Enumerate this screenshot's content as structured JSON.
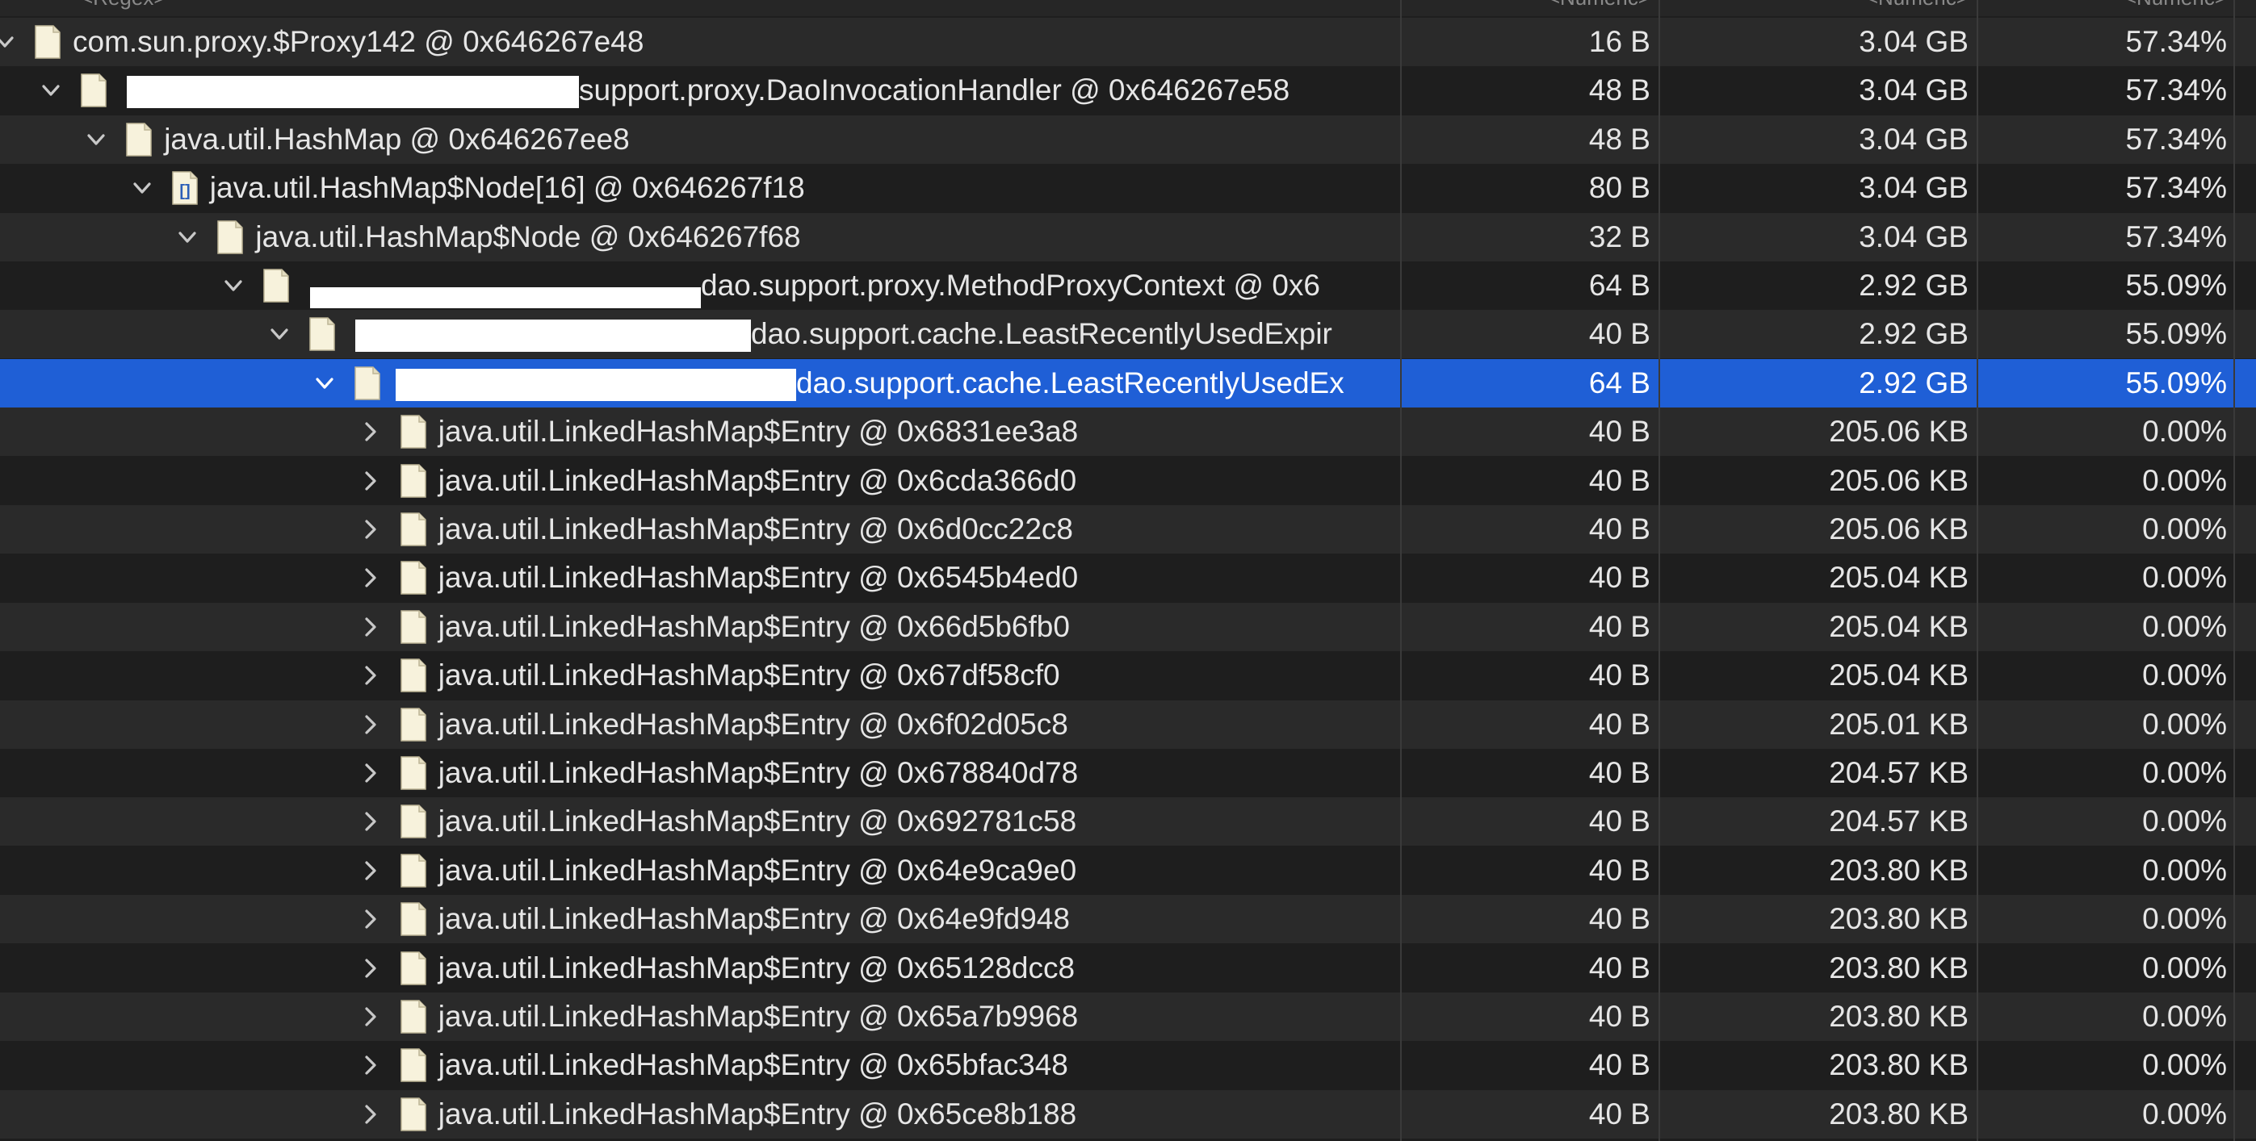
{
  "columns": {
    "name": "<Regex>",
    "shallow": "<Numeric>",
    "retained": "<Numeric>",
    "percent": "<Numeric>"
  },
  "rows": [
    {
      "label": "com.sun.proxy.$Proxy142 @ 0x646267e48",
      "shallow": "16 B",
      "retained": "3.04 GB",
      "percent": "57.34%",
      "icon": "file-icon",
      "expanded": true
    },
    {
      "label": "support.proxy.DaoInvocationHandler @ 0x646267e58",
      "shallow": "48 B",
      "retained": "3.04 GB",
      "percent": "57.34%",
      "icon": "file-icon",
      "expanded": true,
      "redacted": true
    },
    {
      "label": "java.util.HashMap @ 0x646267ee8",
      "shallow": "48 B",
      "retained": "3.04 GB",
      "percent": "57.34%",
      "icon": "file-icon",
      "expanded": true
    },
    {
      "label": "java.util.HashMap$Node[16] @ 0x646267f18",
      "shallow": "80 B",
      "retained": "3.04 GB",
      "percent": "57.34%",
      "icon": "array-icon",
      "expanded": true
    },
    {
      "label": "java.util.HashMap$Node @ 0x646267f68",
      "shallow": "32 B",
      "retained": "3.04 GB",
      "percent": "57.34%",
      "icon": "file-icon",
      "expanded": true
    },
    {
      "label": "dao.support.proxy.MethodProxyContext @ 0x6",
      "shallow": "64 B",
      "retained": "2.92 GB",
      "percent": "55.09%",
      "icon": "file-icon",
      "expanded": true,
      "redacted": true
    },
    {
      "label": "dao.support.cache.LeastRecentlyUsedExpir",
      "shallow": "40 B",
      "retained": "2.92 GB",
      "percent": "55.09%",
      "icon": "file-icon",
      "expanded": true,
      "redacted": true
    },
    {
      "label": "dao.support.cache.LeastRecentlyUsedEx",
      "shallow": "64 B",
      "retained": "2.92 GB",
      "percent": "55.09%",
      "icon": "file-icon",
      "expanded": true,
      "redacted": true,
      "selected": true
    },
    {
      "label": "java.util.LinkedHashMap$Entry @ 0x6831ee3a8",
      "shallow": "40 B",
      "retained": "205.06 KB",
      "percent": "0.00%",
      "icon": "file-icon",
      "expanded": false
    },
    {
      "label": "java.util.LinkedHashMap$Entry @ 0x6cda366d0",
      "shallow": "40 B",
      "retained": "205.06 KB",
      "percent": "0.00%",
      "icon": "file-icon",
      "expanded": false
    },
    {
      "label": "java.util.LinkedHashMap$Entry @ 0x6d0cc22c8",
      "shallow": "40 B",
      "retained": "205.06 KB",
      "percent": "0.00%",
      "icon": "file-icon",
      "expanded": false
    },
    {
      "label": "java.util.LinkedHashMap$Entry @ 0x6545b4ed0",
      "shallow": "40 B",
      "retained": "205.04 KB",
      "percent": "0.00%",
      "icon": "file-icon",
      "expanded": false
    },
    {
      "label": "java.util.LinkedHashMap$Entry @ 0x66d5b6fb0",
      "shallow": "40 B",
      "retained": "205.04 KB",
      "percent": "0.00%",
      "icon": "file-icon",
      "expanded": false
    },
    {
      "label": "java.util.LinkedHashMap$Entry @ 0x67df58cf0",
      "shallow": "40 B",
      "retained": "205.04 KB",
      "percent": "0.00%",
      "icon": "file-icon",
      "expanded": false
    },
    {
      "label": "java.util.LinkedHashMap$Entry @ 0x6f02d05c8",
      "shallow": "40 B",
      "retained": "205.01 KB",
      "percent": "0.00%",
      "icon": "file-icon",
      "expanded": false
    },
    {
      "label": "java.util.LinkedHashMap$Entry @ 0x678840d78",
      "shallow": "40 B",
      "retained": "204.57 KB",
      "percent": "0.00%",
      "icon": "file-icon",
      "expanded": false
    },
    {
      "label": "java.util.LinkedHashMap$Entry @ 0x692781c58",
      "shallow": "40 B",
      "retained": "204.57 KB",
      "percent": "0.00%",
      "icon": "file-icon",
      "expanded": false
    },
    {
      "label": "java.util.LinkedHashMap$Entry @ 0x64e9ca9e0",
      "shallow": "40 B",
      "retained": "203.80 KB",
      "percent": "0.00%",
      "icon": "file-icon",
      "expanded": false
    },
    {
      "label": "java.util.LinkedHashMap$Entry @ 0x64e9fd948",
      "shallow": "40 B",
      "retained": "203.80 KB",
      "percent": "0.00%",
      "icon": "file-icon",
      "expanded": false
    },
    {
      "label": "java.util.LinkedHashMap$Entry @ 0x65128dcc8",
      "shallow": "40 B",
      "retained": "203.80 KB",
      "percent": "0.00%",
      "icon": "file-icon",
      "expanded": false
    },
    {
      "label": "java.util.LinkedHashMap$Entry @ 0x65a7b9968",
      "shallow": "40 B",
      "retained": "203.80 KB",
      "percent": "0.00%",
      "icon": "file-icon",
      "expanded": false
    },
    {
      "label": "java.util.LinkedHashMap$Entry @ 0x65bfac348",
      "shallow": "40 B",
      "retained": "203.80 KB",
      "percent": "0.00%",
      "icon": "file-icon",
      "expanded": false
    },
    {
      "label": "java.util.LinkedHashMap$Entry @ 0x65ce8b188",
      "shallow": "40 B",
      "retained": "203.80 KB",
      "percent": "0.00%",
      "icon": "file-icon",
      "expanded": false
    }
  ],
  "colors": {
    "background": "#1e1e1e",
    "row_alt": "#2a2a2a",
    "selection": "#1f5fd6",
    "text": "#e6e6e6",
    "icon_page": "#f7f2dc"
  }
}
